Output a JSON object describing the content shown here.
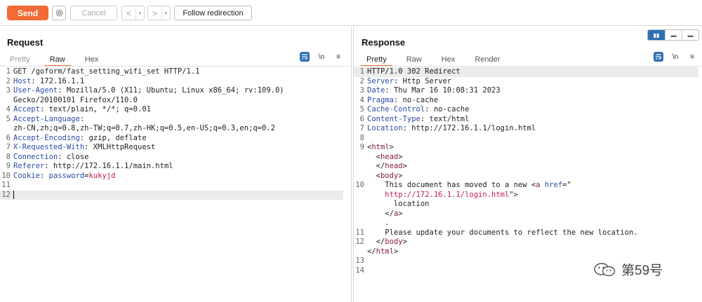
{
  "toolbar": {
    "send_label": "Send",
    "settings_icon": "gear-icon",
    "cancel_label": "Cancel",
    "back_label": "<",
    "forward_label": ">",
    "dropdown_glyph": "▾",
    "follow_label": "Follow redirection",
    "accent_color": "#f26a35"
  },
  "request": {
    "title": "Request",
    "tabs": [
      "Pretty",
      "Raw",
      "Hex"
    ],
    "active_tab": "Raw",
    "tool_newline": "\\n",
    "tool_menu": "≡",
    "lines": [
      {
        "n": "1",
        "segs": [
          [
            "GET /goform/fast_setting_wifi_set HTTP/1.1",
            "plain"
          ]
        ]
      },
      {
        "n": "2",
        "segs": [
          [
            "Host",
            "hk"
          ],
          [
            ": 172.16.1.1",
            "plain"
          ]
        ]
      },
      {
        "n": "3",
        "segs": [
          [
            "User-Agent",
            "hk"
          ],
          [
            ": Mozilla/5.0 (X11; Ubuntu; Linux x86_64; rv:109.0)",
            "plain"
          ]
        ]
      },
      {
        "n": "",
        "segs": [
          [
            "Gecko/20100101 Firefox/110.0",
            "plain"
          ]
        ]
      },
      {
        "n": "4",
        "segs": [
          [
            "Accept",
            "hk"
          ],
          [
            ": text/plain, */*; q=0.01",
            "plain"
          ]
        ]
      },
      {
        "n": "5",
        "segs": [
          [
            "Accept-Language",
            "hk"
          ],
          [
            ":",
            "plain"
          ]
        ]
      },
      {
        "n": "",
        "segs": [
          [
            "zh-CN,zh;q=0.8,zh-TW;q=0.7,zh-HK;q=0.5,en-US;q=0.3,en;q=0.2",
            "plain"
          ]
        ]
      },
      {
        "n": "6",
        "segs": [
          [
            "Accept-Encoding",
            "hk"
          ],
          [
            ": gzip, deflate",
            "plain"
          ]
        ]
      },
      {
        "n": "7",
        "segs": [
          [
            "X-Requested-With",
            "hk"
          ],
          [
            ": XMLHttpRequest",
            "plain"
          ]
        ]
      },
      {
        "n": "8",
        "segs": [
          [
            "Connection",
            "hk"
          ],
          [
            ": close",
            "plain"
          ]
        ]
      },
      {
        "n": "9",
        "segs": [
          [
            "Referer",
            "hk"
          ],
          [
            ": http://172.16.1.1/main.html",
            "plain"
          ]
        ]
      },
      {
        "n": "10",
        "segs": [
          [
            "Cookie",
            "hk"
          ],
          [
            ": ",
            "plain"
          ],
          [
            "password",
            "tn"
          ],
          [
            "=",
            "plain"
          ],
          [
            "kukyjd",
            "sv"
          ]
        ]
      },
      {
        "n": "11",
        "segs": []
      },
      {
        "n": "12",
        "segs": [],
        "highlight": true,
        "caret": true
      }
    ]
  },
  "response": {
    "title": "Response",
    "tabs": [
      "Pretty",
      "Raw",
      "Hex",
      "Render"
    ],
    "active_tab": "Pretty",
    "tool_newline": "\\n",
    "tool_menu": "≡",
    "layout_buttons": [
      "▮▮",
      "▬",
      "▬"
    ],
    "lines": [
      {
        "n": "1",
        "segs": [
          [
            "HTTP/1.0 302 Redirect",
            "plain"
          ]
        ],
        "highlight": true
      },
      {
        "n": "2",
        "segs": [
          [
            "Server",
            "hk"
          ],
          [
            ": Http Server",
            "plain"
          ]
        ]
      },
      {
        "n": "3",
        "segs": [
          [
            "Date",
            "hk"
          ],
          [
            ": Thu Mar 16 10:08:31 2023",
            "plain"
          ]
        ]
      },
      {
        "n": "4",
        "segs": [
          [
            "Pragma",
            "hk"
          ],
          [
            ": no-cache",
            "plain"
          ]
        ]
      },
      {
        "n": "5",
        "segs": [
          [
            "Cache-Control",
            "hk"
          ],
          [
            ": no-cache",
            "plain"
          ]
        ]
      },
      {
        "n": "6",
        "segs": [
          [
            "Content-Type",
            "hk"
          ],
          [
            ": text/html",
            "plain"
          ]
        ]
      },
      {
        "n": "7",
        "segs": [
          [
            "Location",
            "hk"
          ],
          [
            ": http://172.16.1.1/login.html",
            "plain"
          ]
        ]
      },
      {
        "n": "8",
        "segs": []
      },
      {
        "n": "9",
        "segs": [
          [
            "<",
            "plain"
          ],
          [
            "html",
            "tg"
          ],
          [
            ">",
            "plain"
          ]
        ]
      },
      {
        "n": "",
        "segs": [
          [
            "  <",
            "plain"
          ],
          [
            "head",
            "tg"
          ],
          [
            ">",
            "plain"
          ]
        ]
      },
      {
        "n": "",
        "segs": [
          [
            "  </",
            "plain"
          ],
          [
            "head",
            "tg"
          ],
          [
            ">",
            "plain"
          ]
        ]
      },
      {
        "n": "",
        "segs": [
          [
            "  <",
            "plain"
          ],
          [
            "body",
            "tg"
          ],
          [
            ">",
            "plain"
          ]
        ]
      },
      {
        "n": "10",
        "segs": [
          [
            "    This document has moved to a new <",
            "plain"
          ],
          [
            "a",
            "tg"
          ],
          [
            " ",
            "plain"
          ],
          [
            "href",
            "tn"
          ],
          [
            "=\"",
            "plain"
          ]
        ]
      },
      {
        "n": "",
        "segs": [
          [
            "    ",
            "plain"
          ],
          [
            "http://172.16.1.1/login.html",
            "sv"
          ],
          [
            "\">",
            "plain"
          ]
        ]
      },
      {
        "n": "",
        "segs": [
          [
            "      location",
            "plain"
          ]
        ]
      },
      {
        "n": "",
        "segs": [
          [
            "    </",
            "plain"
          ],
          [
            "a",
            "tg"
          ],
          [
            ">",
            "plain"
          ]
        ]
      },
      {
        "n": "",
        "segs": [
          [
            "    .",
            "plain"
          ]
        ]
      },
      {
        "n": "11",
        "segs": [
          [
            "    Please update your documents to reflect the new location.",
            "plain"
          ]
        ]
      },
      {
        "n": "12",
        "segs": [
          [
            "  </",
            "plain"
          ],
          [
            "body",
            "tg"
          ],
          [
            ">",
            "plain"
          ]
        ]
      },
      {
        "n": "",
        "segs": [
          [
            "</",
            "plain"
          ],
          [
            "html",
            "tg"
          ],
          [
            ">",
            "plain"
          ]
        ]
      },
      {
        "n": "13",
        "segs": []
      },
      {
        "n": "14",
        "segs": []
      }
    ]
  },
  "watermark": {
    "text": "第59号",
    "icon": "wechat-icon"
  }
}
